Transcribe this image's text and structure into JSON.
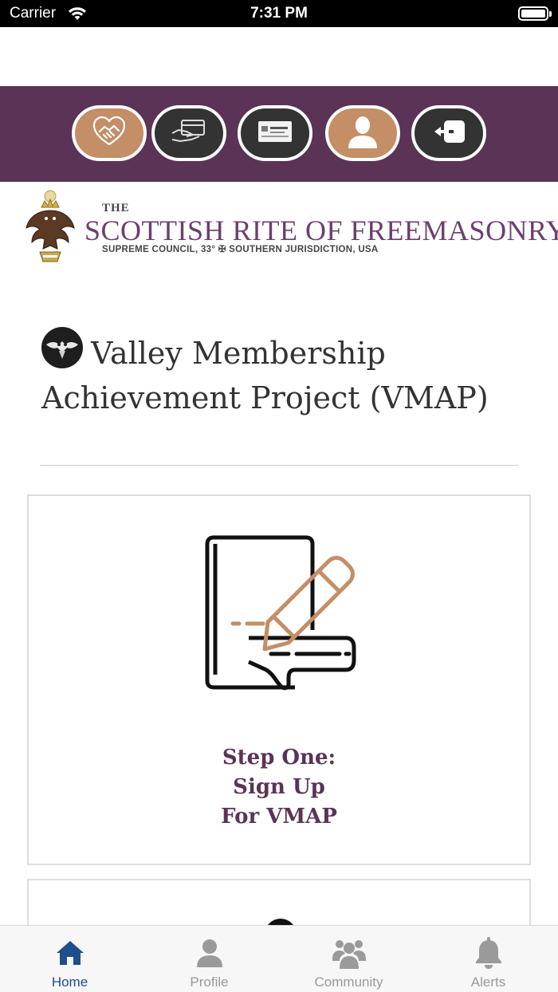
{
  "status_bar": {
    "carrier": "Carrier",
    "time": "7:31 PM"
  },
  "toolbar": {
    "buttons": [
      {
        "icon": "handshake-heart-icon",
        "color": "#c48e66"
      },
      {
        "icon": "card-in-hand-icon",
        "color": "#333333"
      },
      {
        "icon": "member-card-icon",
        "color": "#333333"
      },
      {
        "icon": "person-icon",
        "color": "#c48e66"
      },
      {
        "icon": "logout-icon",
        "color": "#333333"
      }
    ],
    "background": "#5a3356"
  },
  "logo": {
    "the": "THE",
    "name": "SCOTTISH RITE OF FREEMASONRY",
    "subtitle": "SUPREME COUNCIL, 33° ✠ SOUTHERN JURISDICTION, USA"
  },
  "page": {
    "title": "Valley Membership Achievement Project (VMAP)"
  },
  "cards": [
    {
      "icon": "sign-up-document-icon",
      "title_lines": [
        "Step One:",
        "Sign Up",
        "For VMAP"
      ]
    }
  ],
  "tabbar": {
    "tabs": [
      {
        "label": "Home",
        "icon": "home-icon",
        "active": true
      },
      {
        "label": "Profile",
        "icon": "profile-icon",
        "active": false
      },
      {
        "label": "Community",
        "icon": "community-icon",
        "active": false
      },
      {
        "label": "Alerts",
        "icon": "bell-icon",
        "active": false
      }
    ],
    "active_color": "#1f4e8a"
  }
}
